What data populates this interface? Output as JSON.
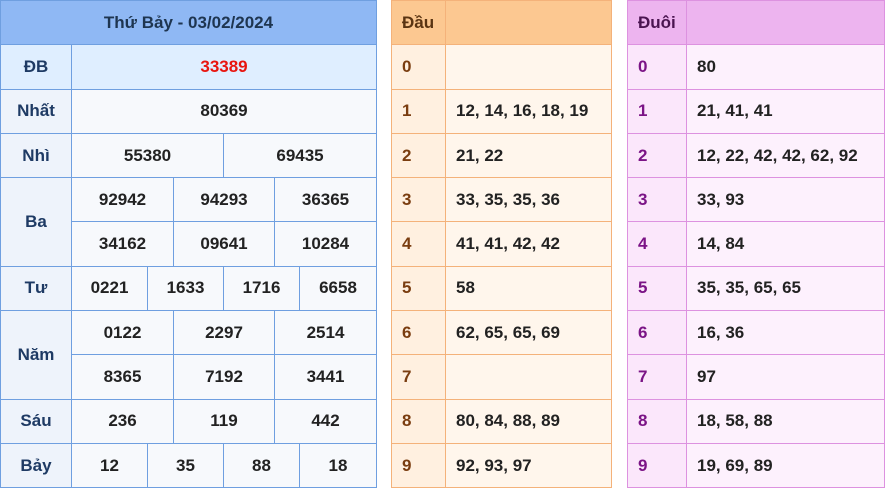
{
  "results": {
    "header": "Thứ Bảy - 03/02/2024",
    "prizes": {
      "db": {
        "label": "ĐB",
        "values": [
          "33389"
        ]
      },
      "nhat": {
        "label": "Nhất",
        "values": [
          "80369"
        ]
      },
      "nhi": {
        "label": "Nhì",
        "values": [
          "55380",
          "69435"
        ]
      },
      "ba": {
        "label": "Ba",
        "values": [
          "92942",
          "94293",
          "36365",
          "34162",
          "09641",
          "10284"
        ]
      },
      "tu": {
        "label": "Tư",
        "values": [
          "0221",
          "1633",
          "1716",
          "6658"
        ]
      },
      "nam": {
        "label": "Năm",
        "values": [
          "0122",
          "2297",
          "2514",
          "8365",
          "7192",
          "3441"
        ]
      },
      "sau": {
        "label": "Sáu",
        "values": [
          "236",
          "119",
          "442"
        ]
      },
      "bay": {
        "label": "Bảy",
        "values": [
          "12",
          "35",
          "88",
          "18"
        ]
      }
    }
  },
  "dau": {
    "header": "Đầu",
    "rows": [
      {
        "digit": "0",
        "values": ""
      },
      {
        "digit": "1",
        "values": "12, 14, 16, 18, 19"
      },
      {
        "digit": "2",
        "values": "21, 22"
      },
      {
        "digit": "3",
        "values": "33, 35, 35, 36"
      },
      {
        "digit": "4",
        "values": "41, 41, 42, 42"
      },
      {
        "digit": "5",
        "values": "58"
      },
      {
        "digit": "6",
        "values": "62, 65, 65, 69"
      },
      {
        "digit": "7",
        "values": ""
      },
      {
        "digit": "8",
        "values": "80, 84, 88, 89"
      },
      {
        "digit": "9",
        "values": "92, 93, 97"
      }
    ]
  },
  "duoi": {
    "header": "Đuôi",
    "rows": [
      {
        "digit": "0",
        "values": "80"
      },
      {
        "digit": "1",
        "values": "21, 41, 41"
      },
      {
        "digit": "2",
        "values": "12, 22, 42, 42, 62, 92"
      },
      {
        "digit": "3",
        "values": "33, 93"
      },
      {
        "digit": "4",
        "values": "14, 84"
      },
      {
        "digit": "5",
        "values": "35, 35, 65, 65"
      },
      {
        "digit": "6",
        "values": "16, 36"
      },
      {
        "digit": "7",
        "values": "97"
      },
      {
        "digit": "8",
        "values": "18, 58, 88"
      },
      {
        "digit": "9",
        "values": "19, 69, 89"
      }
    ]
  },
  "colors": {
    "results_header": "#8fb8f4",
    "special_prize_text": "#e8140f",
    "dau_header": "#fcc891",
    "duoi_header": "#edb4ef"
  }
}
